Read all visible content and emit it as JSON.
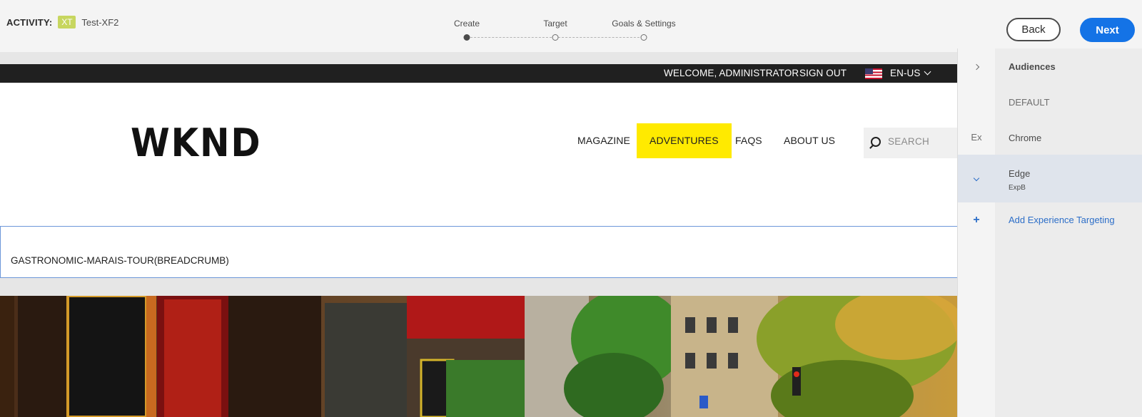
{
  "activity": {
    "label": "ACTIVITY:",
    "badge": "XT",
    "name": "Test-XF2"
  },
  "steps": [
    {
      "label": "Create",
      "active": true
    },
    {
      "label": "Target",
      "active": false
    },
    {
      "label": "Goals & Settings",
      "active": false
    }
  ],
  "buttons": {
    "back": "Back",
    "next": "Next"
  },
  "site": {
    "utility": {
      "welcome": "WELCOME, ADMINISTRATOR",
      "sign_out": "SIGN OUT",
      "language": "EN-US"
    },
    "logo": "WKND",
    "nav": [
      "MAGAZINE",
      "ADVENTURES",
      "FAQS",
      "ABOUT US"
    ],
    "search_placeholder": "SEARCH",
    "breadcrumb": "GASTRONOMIC-MARAIS-TOUR(BREADCRUMB)"
  },
  "panel": {
    "audiences_label": "Audiences",
    "experiences": [
      {
        "label": "DEFAULT",
        "rail": ""
      },
      {
        "label": "Chrome",
        "rail": "Ex"
      },
      {
        "label": "Edge",
        "sub": "ExpB",
        "selected": true
      }
    ],
    "add_label": "Add Experience Targeting"
  },
  "colors": {
    "accent": "#1473e6",
    "nav_highlight": "#ffea00",
    "activity_badge": "#c7d65f",
    "link": "#2c6ec8"
  }
}
